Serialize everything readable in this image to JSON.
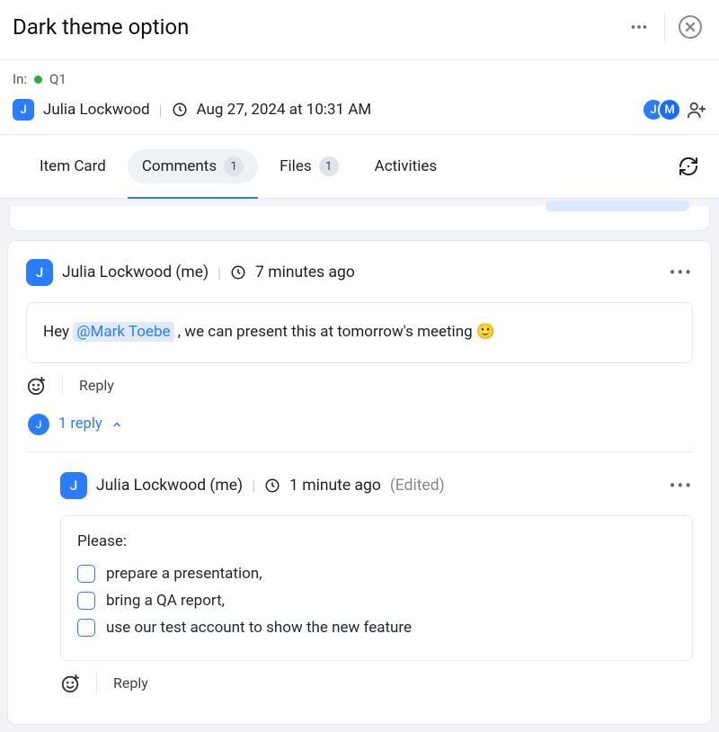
{
  "header": {
    "title": "Dark theme option"
  },
  "meta": {
    "in_label": "In:",
    "location": "Q1",
    "author": "Julia Lockwood",
    "author_initial": "J",
    "created": "Aug 27, 2024 at 10:31 AM",
    "collaborators": [
      {
        "initial": "J",
        "color": "#2a7dff"
      },
      {
        "initial": "M",
        "color": "#1a6bff"
      }
    ]
  },
  "tabs": {
    "item_card": "Item Card",
    "comments": "Comments",
    "comments_count": "1",
    "files": "Files",
    "files_count": "1",
    "activities": "Activities"
  },
  "comment": {
    "author_initial": "J",
    "author": "Julia Lockwood (me)",
    "time": "7 minutes ago",
    "prefix": "Hey ",
    "mention": "@Mark Toebe",
    "suffix": " , we can present this at tomorrow's meeting 🙂",
    "reply_label": "Reply",
    "thread_initial": "J",
    "thread_label": "1 reply"
  },
  "reply": {
    "author_initial": "J",
    "author": "Julia Lockwood (me)",
    "time": "1 minute ago",
    "edited": "(Edited)",
    "intro": "Please:",
    "items": [
      "prepare a presentation,",
      "bring a QA report,",
      "use our test account to show the new feature"
    ],
    "reply_label": "Reply"
  }
}
